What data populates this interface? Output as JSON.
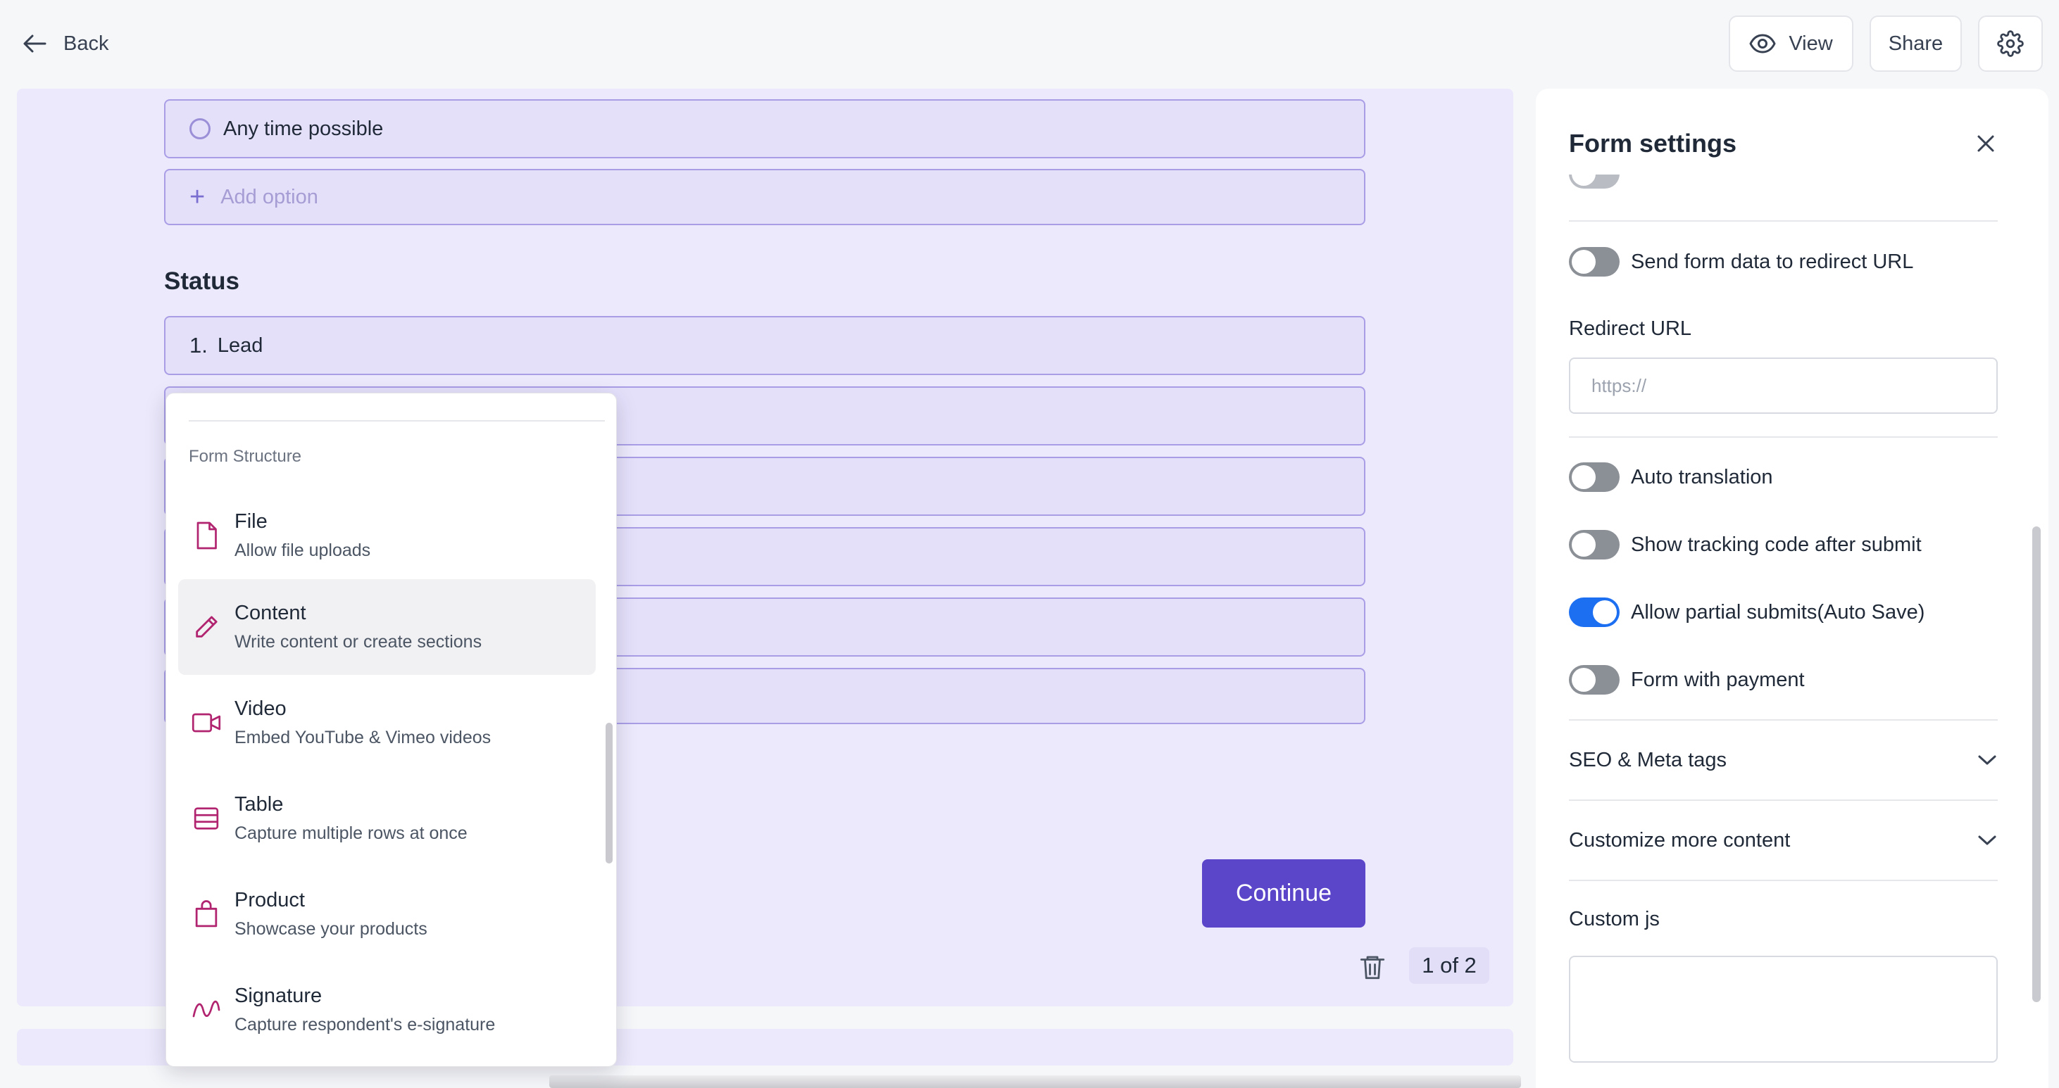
{
  "header": {
    "back_label": "Back",
    "view_label": "View",
    "share_label": "Share"
  },
  "form": {
    "option_any_time": "Any time possible",
    "add_option_placeholder": "Add option",
    "status_title": "Status",
    "status_first_number": "1.",
    "status_first_label": "Lead",
    "continue_label": "Continue",
    "pager": "1 of 2"
  },
  "dropdown": {
    "section_title": "Form Structure",
    "items": [
      {
        "title": "File",
        "desc": "Allow file uploads",
        "icon": "file-icon"
      },
      {
        "title": "Content",
        "desc": "Write content or create sections",
        "icon": "pencil-icon"
      },
      {
        "title": "Video",
        "desc": "Embed YouTube & Vimeo videos",
        "icon": "video-icon"
      },
      {
        "title": "Table",
        "desc": "Capture multiple rows at once",
        "icon": "table-icon"
      },
      {
        "title": "Product",
        "desc": "Showcase your products",
        "icon": "shopping-bag-icon"
      },
      {
        "title": "Signature",
        "desc": "Capture respondent's e-signature",
        "icon": "signature-icon"
      }
    ]
  },
  "settings": {
    "title": "Form settings",
    "send_form_data_label": "Send form data to redirect URL",
    "redirect_url_label": "Redirect URL",
    "redirect_url_placeholder": "https://",
    "auto_translation_label": "Auto translation",
    "tracking_code_label": "Show tracking code after submit",
    "partial_submits_label": "Allow partial submits(Auto Save)",
    "payment_label": "Form with payment",
    "seo_label": "SEO & Meta tags",
    "customize_label": "Customize more content",
    "custom_js_label": "Custom js"
  },
  "colors": {
    "accent": "#5b45c9",
    "toggle_on": "#1d6ff2",
    "icon_pink": "#b1246f",
    "canvas_bg": "#ece9fc"
  }
}
